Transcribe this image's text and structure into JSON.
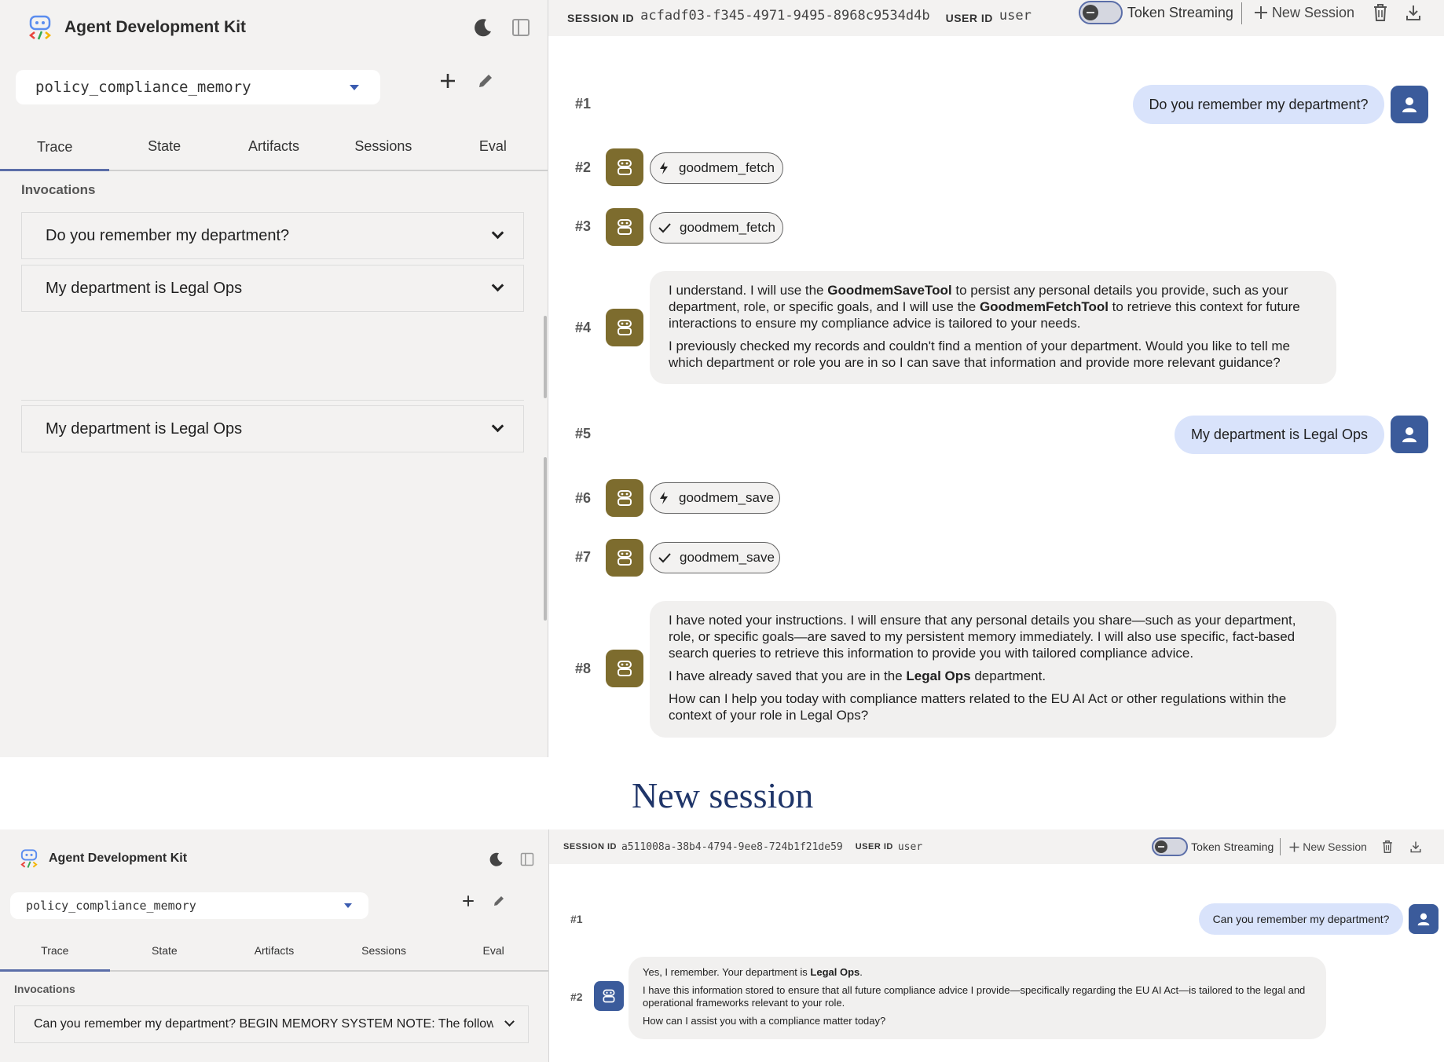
{
  "app": {
    "brand": "Agent Development Kit",
    "colors": {
      "accent": "#5b6ea8",
      "user_avatar": "#3b5b9b",
      "bot_avatar": "#7d6c2e",
      "user_bubble": "#d9e3fb",
      "caption": "#1f3569"
    },
    "icons": [
      "adk-logo-icon",
      "moon-icon",
      "sidebar-collapse-icon",
      "plus-icon",
      "pencil-icon",
      "trash-icon",
      "download-icon",
      "person-icon",
      "robot-icon",
      "bolt-icon",
      "check-icon",
      "chevron-down-icon"
    ]
  },
  "caption": "New session",
  "session1": {
    "header": {
      "session_id_label": "SESSION ID",
      "session_id": "acfadf03-f345-4971-9495-8968c9534d4b",
      "user_id_label": "USER ID",
      "user_id": "user",
      "token_streaming": "Token Streaming",
      "new_session": "New Session"
    },
    "sidebar": {
      "agent": "policy_compliance_memory",
      "tabs": [
        "Trace",
        "State",
        "Artifacts",
        "Sessions",
        "Eval"
      ],
      "section": "Invocations",
      "invocations": [
        "Do you remember my department?",
        "My department is Legal Ops",
        "My department is Legal Ops"
      ]
    },
    "messages": {
      "m1": {
        "num": "#1",
        "text": "Do you remember my department?"
      },
      "m2": {
        "num": "#2",
        "tool": "goodmem_fetch"
      },
      "m3": {
        "num": "#3",
        "tool": "goodmem_fetch"
      },
      "m4": {
        "num": "#4",
        "p1_a": "I understand. I will use the ",
        "p1_b": "GoodmemSaveTool",
        "p1_c": " to persist any personal details you provide, such as your department, role, or specific goals, and I will use the ",
        "p1_d": "GoodmemFetchTool",
        "p1_e": " to retrieve this context for future interactions to ensure my compliance advice is tailored to your needs.",
        "p2": "I previously checked my records and couldn't find a mention of your department. Would you like to tell me which department or role you are in so I can save that information and provide more relevant guidance?"
      },
      "m5": {
        "num": "#5",
        "text": "My department is Legal Ops"
      },
      "m6": {
        "num": "#6",
        "tool": "goodmem_save"
      },
      "m7": {
        "num": "#7",
        "tool": "goodmem_save"
      },
      "m8": {
        "num": "#8",
        "p1": "I have noted your instructions. I will ensure that any personal details you share—such as your department, role, or specific goals—are saved to my persistent memory immediately. I will also use specific, fact-based search queries to retrieve this information to provide you with tailored compliance advice.",
        "p2_a": "I have already saved that you are in the ",
        "p2_b": "Legal Ops",
        "p2_c": " department.",
        "p3": "How can I help you today with compliance matters related to the EU AI Act or other regulations within the context of your role in Legal Ops?"
      }
    }
  },
  "session2": {
    "header": {
      "session_id_label": "SESSION ID",
      "session_id": "a511008a-38b4-4794-9ee8-724b1f21de59",
      "user_id_label": "USER ID",
      "user_id": "user",
      "token_streaming": "Token Streaming",
      "new_session": "New Session"
    },
    "sidebar": {
      "agent": "policy_compliance_memory",
      "tabs": [
        "Trace",
        "State",
        "Artifacts",
        "Sessions",
        "Eval"
      ],
      "section": "Invocations",
      "invocations": [
        "Can you remember my department? BEGIN MEMORY SYSTEM NOTE: The following i"
      ]
    },
    "messages": {
      "m1": {
        "num": "#1",
        "text": "Can you remember my department?"
      },
      "m2": {
        "num": "#2",
        "p1_a": "Yes, I remember. Your department is ",
        "p1_b": "Legal Ops",
        "p1_c": ".",
        "p2": "I have this information stored to ensure that all future compliance advice I provide—specifically regarding the EU AI Act—is tailored to the legal and operational frameworks relevant to your role.",
        "p3": "How can I assist you with a compliance matter today?"
      }
    }
  }
}
